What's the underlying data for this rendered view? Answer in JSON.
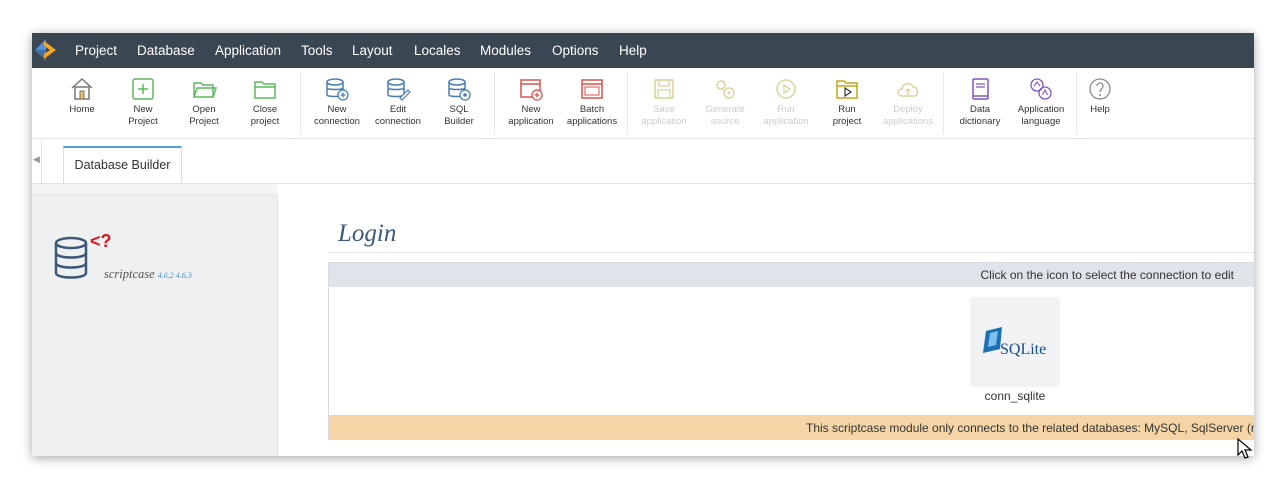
{
  "menubar": {
    "items": [
      "Project",
      "Database",
      "Application",
      "Tools",
      "Layout",
      "Locales",
      "Modules",
      "Options",
      "Help"
    ],
    "bg_color": "#3a4652",
    "logo_colors": [
      "#f5a623",
      "#4a90e2"
    ]
  },
  "toolbar": {
    "buttons": [
      {
        "label1": "Home",
        "label2": "",
        "icon": "home-icon",
        "enabled": true
      },
      {
        "label1": "New",
        "label2": "Project",
        "icon": "new-project-icon",
        "enabled": true
      },
      {
        "label1": "Open",
        "label2": "Project",
        "icon": "folder-open-icon",
        "enabled": true
      },
      {
        "label1": "Close",
        "label2": "project",
        "icon": "folder-close-icon",
        "enabled": true
      },
      {
        "label1": "New",
        "label2": "connection",
        "icon": "database-add-icon",
        "enabled": true
      },
      {
        "label1": "Edit",
        "label2": "connection",
        "icon": "database-edit-icon",
        "enabled": true
      },
      {
        "label1": "SQL",
        "label2": "Builder",
        "icon": "database-gear-icon",
        "enabled": true
      },
      {
        "label1": "New",
        "label2": "application",
        "icon": "window-add-icon",
        "enabled": true
      },
      {
        "label1": "Batch",
        "label2": "applications",
        "icon": "window-batch-icon",
        "enabled": true
      },
      {
        "label1": "Save",
        "label2": "application",
        "icon": "save-icon",
        "enabled": false
      },
      {
        "label1": "Generate",
        "label2": "source",
        "icon": "gears-icon",
        "enabled": false
      },
      {
        "label1": "Run",
        "label2": "application",
        "icon": "play-circle-icon",
        "enabled": false
      },
      {
        "label1": "Run",
        "label2": "project",
        "icon": "folder-play-icon",
        "enabled": true
      },
      {
        "label1": "Deploy",
        "label2": "applications",
        "icon": "cloud-upload-icon",
        "enabled": false
      },
      {
        "label1": "Data",
        "label2": "dictionary",
        "icon": "dictionary-icon",
        "enabled": true
      },
      {
        "label1": "Application",
        "label2": "language",
        "icon": "language-icon",
        "enabled": true
      },
      {
        "label1": "Help",
        "label2": "",
        "icon": "help-icon",
        "enabled": true
      }
    ],
    "accent_green": "#5cb85c",
    "accent_blue": "#4a7fb5",
    "accent_red": "#d9534f",
    "accent_gold": "#c8a416",
    "accent_purple": "#7e57c2"
  },
  "tabs": {
    "items": [
      {
        "label": "Database Builder"
      }
    ],
    "active_color": "#4fa3d8"
  },
  "side_panel": {
    "brand": "scriptcase",
    "versions": "4.6.2 4.6.3",
    "logo_badge": "<?"
  },
  "main": {
    "title": "Login",
    "instruction": "Click on the icon to select the connection to edit",
    "connections": [
      {
        "name": "conn_sqlite",
        "logo_text": "SQLite"
      }
    ],
    "warning": "This scriptcase module only connects to the related databases: MySQL, SqlServer (n",
    "warning_color": "#f5d5a5"
  }
}
